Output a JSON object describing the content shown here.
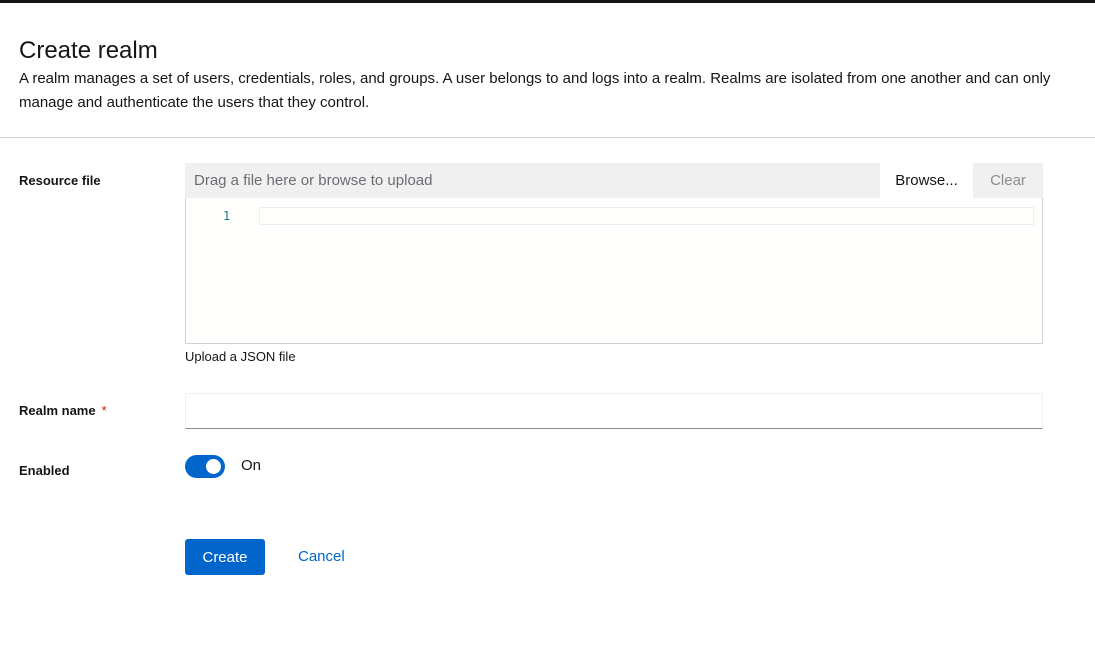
{
  "header": {
    "title": "Create realm",
    "description": "A realm manages a set of users, credentials, roles, and groups. A user belongs to and logs into a realm. Realms are isolated from one another and can only manage and authenticate the users that they control."
  },
  "form": {
    "resource_file": {
      "label": "Resource file",
      "placeholder": "Drag a file here or browse to upload",
      "browse_label": "Browse...",
      "clear_label": "Clear",
      "editor_line_number": "1",
      "helper_text": "Upload a JSON file"
    },
    "realm_name": {
      "label": "Realm name",
      "required_mark": "*",
      "value": ""
    },
    "enabled": {
      "label": "Enabled",
      "state_label": "On",
      "checked": true
    }
  },
  "actions": {
    "create_label": "Create",
    "cancel_label": "Cancel"
  },
  "colors": {
    "primary": "#0066cc",
    "required": "#c9190b"
  }
}
